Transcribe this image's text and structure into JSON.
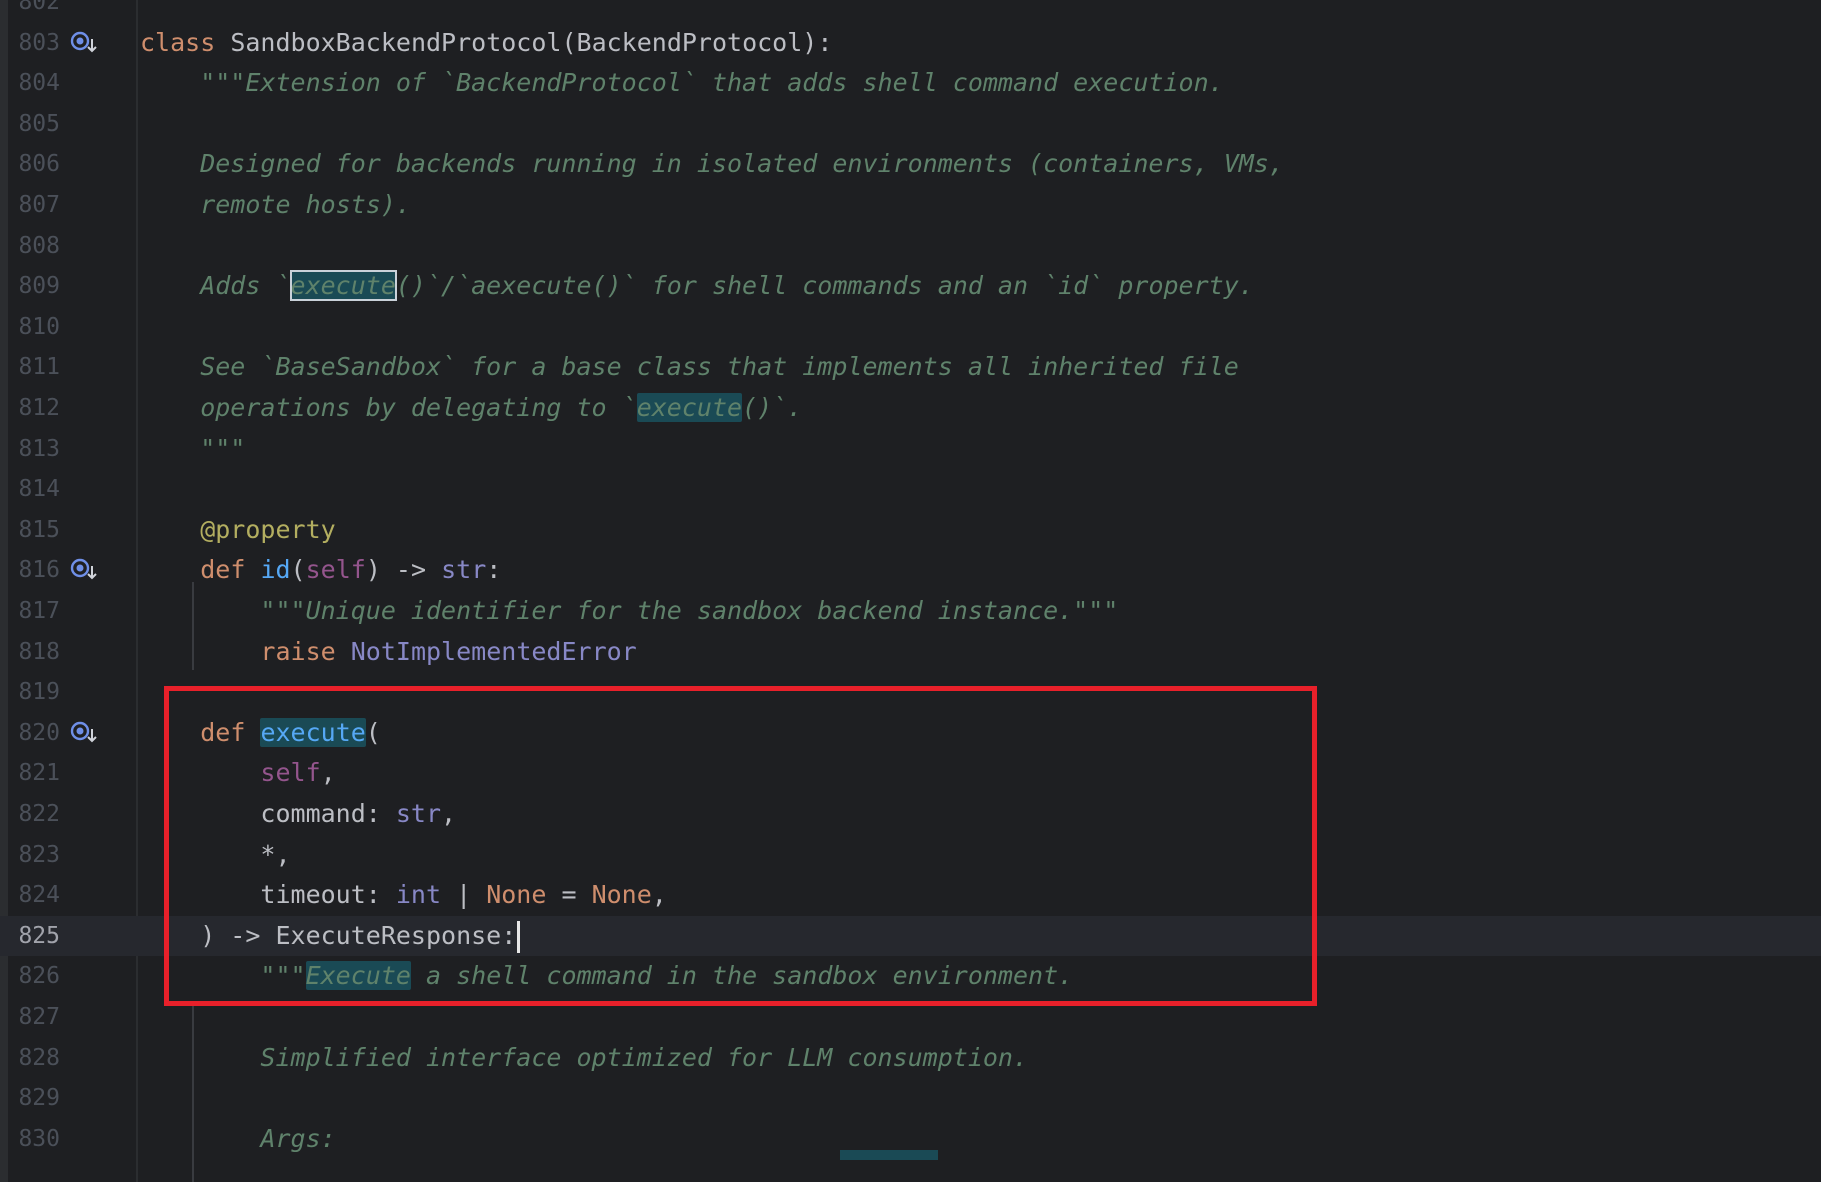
{
  "editor": {
    "current_line": "825",
    "lines": [
      {
        "num": "802",
        "code": ""
      },
      {
        "num": "803",
        "code": "class SandboxBackendProtocol(BackendProtocol):"
      },
      {
        "num": "804",
        "code": "    \"\"\"Extension of `BackendProtocol` that adds shell command execution."
      },
      {
        "num": "805",
        "code": ""
      },
      {
        "num": "806",
        "code": "    Designed for backends running in isolated environments (containers, VMs,"
      },
      {
        "num": "807",
        "code": "    remote hosts)."
      },
      {
        "num": "808",
        "code": ""
      },
      {
        "num": "809",
        "code": "    Adds `execute()`/`aexecute()` for shell commands and an `id` property."
      },
      {
        "num": "810",
        "code": ""
      },
      {
        "num": "811",
        "code": "    See `BaseSandbox` for a base class that implements all inherited file"
      },
      {
        "num": "812",
        "code": "    operations by delegating to `execute()`."
      },
      {
        "num": "813",
        "code": "    \"\"\""
      },
      {
        "num": "814",
        "code": ""
      },
      {
        "num": "815",
        "code": "    @property"
      },
      {
        "num": "816",
        "code": "    def id(self) -> str:"
      },
      {
        "num": "817",
        "code": "        \"\"\"Unique identifier for the sandbox backend instance.\"\"\""
      },
      {
        "num": "818",
        "code": "        raise NotImplementedError"
      },
      {
        "num": "819",
        "code": ""
      },
      {
        "num": "820",
        "code": "    def execute("
      },
      {
        "num": "821",
        "code": "        self,"
      },
      {
        "num": "822",
        "code": "        command: str,"
      },
      {
        "num": "823",
        "code": "        *,"
      },
      {
        "num": "824",
        "code": "        timeout: int | None = None,"
      },
      {
        "num": "825",
        "code": "    ) -> ExecuteResponse:"
      },
      {
        "num": "826",
        "code": "        \"\"\"Execute a shell command in the sandbox environment."
      },
      {
        "num": "827",
        "code": ""
      },
      {
        "num": "828",
        "code": "        Simplified interface optimized for LLM consumption."
      },
      {
        "num": "829",
        "code": ""
      },
      {
        "num": "830",
        "code": "        Args:"
      }
    ]
  },
  "gutter_icons": [
    "implementation-icon",
    "implementation-icon",
    "implementation-icon"
  ],
  "colors": {
    "background": "#1e1f22",
    "keyword": "#cf8e6d",
    "function": "#56a8f5",
    "self": "#94558d",
    "builtin": "#8888c6",
    "docstring": "#5f826b",
    "decorator": "#b3ae60",
    "highlight_box": "#e8202a"
  }
}
